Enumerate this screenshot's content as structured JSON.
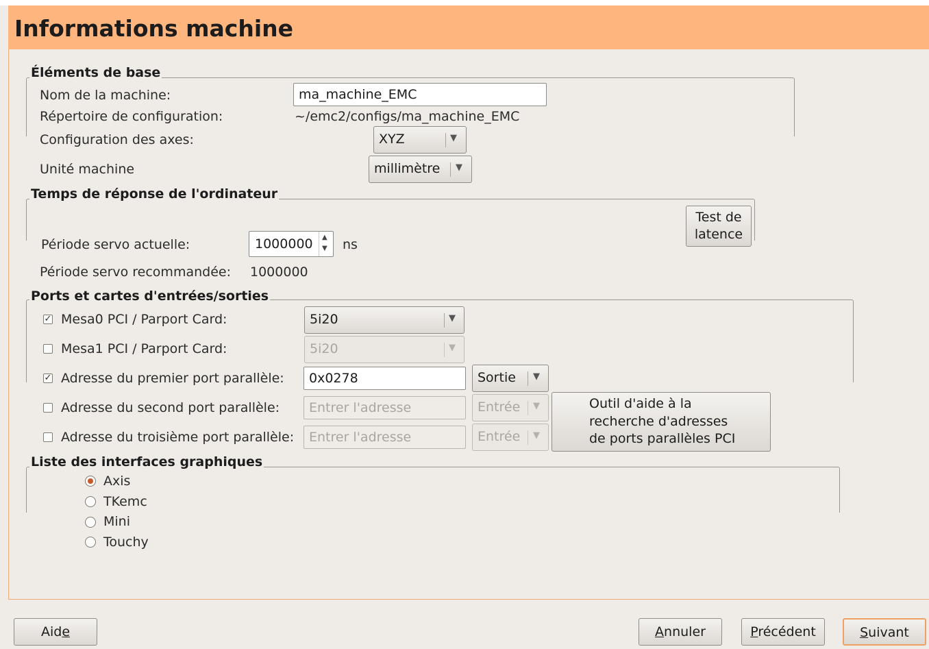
{
  "header": {
    "title": "Informations machine"
  },
  "basics": {
    "title": "Éléments de base",
    "machine_name_label": "Nom de la machine:",
    "machine_name_value": "ma_machine_EMC",
    "config_dir_label": "Répertoire de configuration:",
    "config_dir_value": "~/emc2/configs/ma_machine_EMC",
    "axes_label": "Configuration des axes:",
    "axes_value": "XYZ",
    "units_label": "Unité machine",
    "units_value": "millimètre"
  },
  "latency": {
    "title": "Temps de réponse de l'ordinateur",
    "test_button": [
      "Test de",
      "latence"
    ],
    "servo_label": "Période servo actuelle:",
    "servo_value": "1000000",
    "servo_unit": "ns",
    "recommended_label": "Période servo recommandée:",
    "recommended_value": "1000000"
  },
  "io": {
    "title": "Ports et cartes d'entrées/sorties",
    "mesa0": {
      "checked": true,
      "label": "Mesa0 PCI / Parport Card:",
      "value": "5i20"
    },
    "mesa1": {
      "checked": false,
      "label": "Mesa1 PCI / Parport Card:",
      "value": "5i20"
    },
    "port1": {
      "checked": true,
      "label": "Adresse du premier port parallèle:",
      "value": "0x0278",
      "direction": "Sortie"
    },
    "port2": {
      "checked": false,
      "label": "Adresse du second port parallèle:",
      "placeholder": "Entrer l'adresse",
      "direction": "Entrée"
    },
    "port3": {
      "checked": false,
      "label": "Adresse du troisième port parallèle:",
      "placeholder": "Entrer l'adresse",
      "direction": "Entrée"
    },
    "pci_helper_button": [
      "Outil d'aide à la",
      "recherche d'adresses",
      "de ports parallèles PCI"
    ]
  },
  "gui": {
    "title": "Liste des interfaces graphiques",
    "options": [
      "Axis",
      "TKemc",
      "Mini",
      "Touchy"
    ],
    "selected": "Axis"
  },
  "footer": {
    "help": {
      "pre": "Aid",
      "mnemonic": "e",
      "post": ""
    },
    "cancel": {
      "pre": "",
      "mnemonic": "A",
      "post": "nnuler"
    },
    "previous": {
      "pre": "",
      "mnemonic": "P",
      "post": "récédent"
    },
    "next": {
      "pre": "",
      "mnemonic": "S",
      "post": "uivant"
    }
  }
}
